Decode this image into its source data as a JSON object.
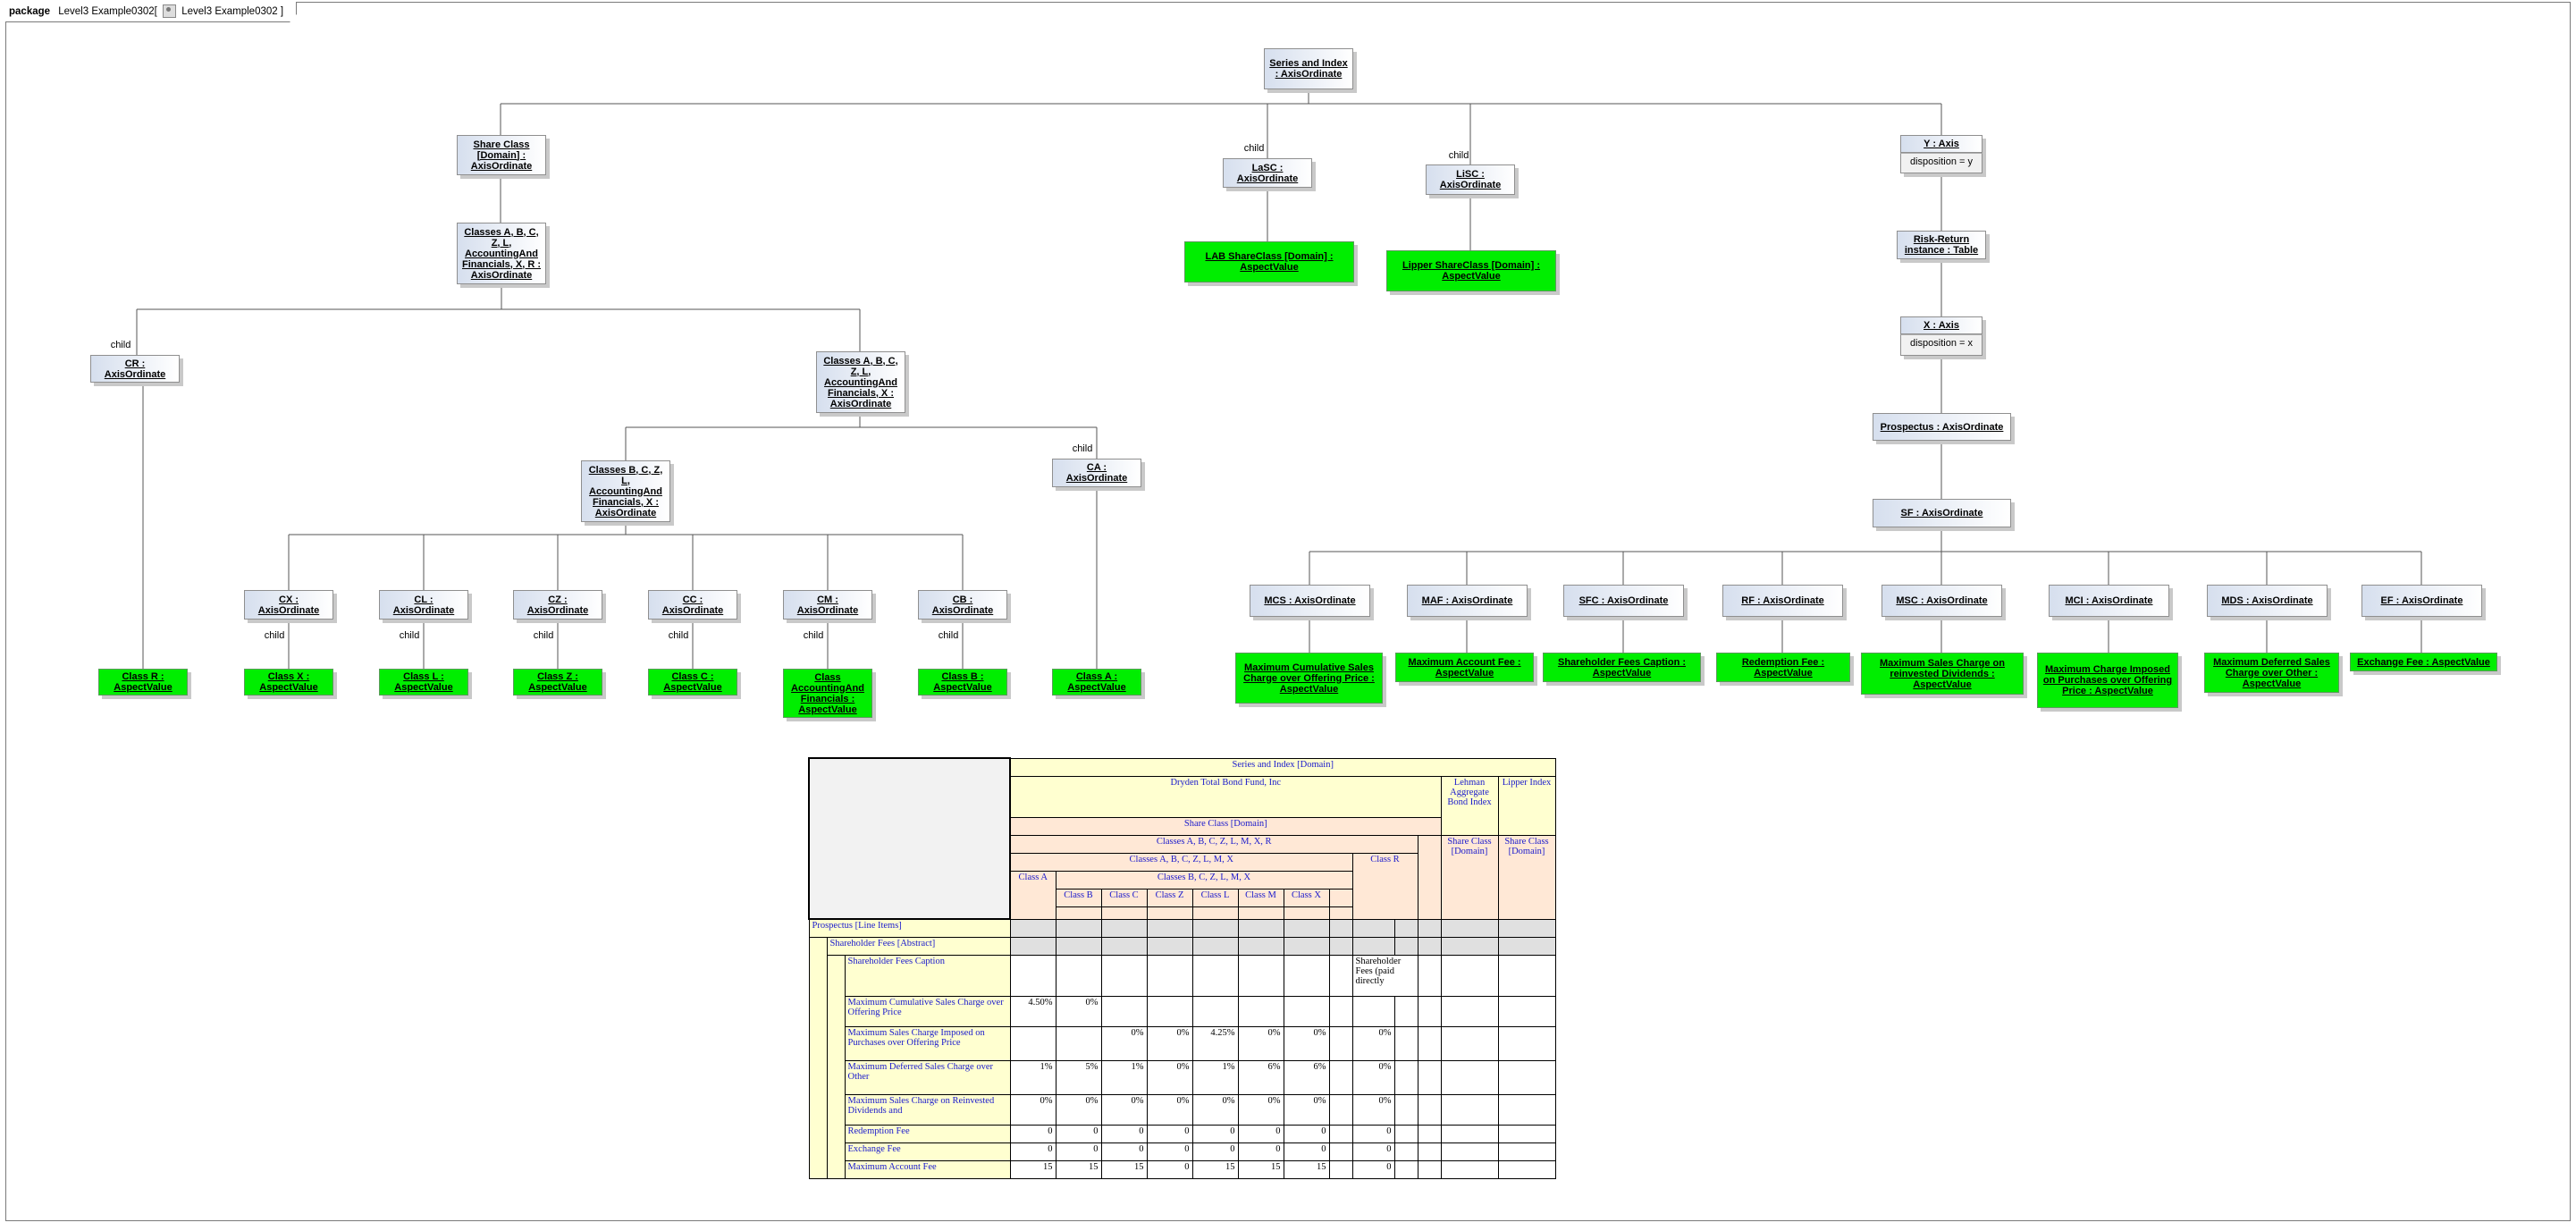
{
  "package": {
    "keyword": "package",
    "name": "Level3 Example0302",
    "diagram_ref": "Level3 Example0302"
  },
  "edge_label": "child",
  "nodes": {
    "series_index": "Series and Index : AxisOrdinate",
    "share_class": "Share Class [Domain] : AxisOrdinate",
    "classes_abcz_r": "Classes A, B, C, Z, L, AccountingAnd Financials, X, R : AxisOrdinate",
    "cr": "CR : AxisOrdinate",
    "classes_abcz_x": "Classes A, B, C, Z, L, AccountingAnd Financials, X : AxisOrdinate",
    "classes_bcz": "Classes B, C, Z, L, AccountingAnd Financials, X : AxisOrdinate",
    "ca": "CA : AxisOrdinate",
    "cx": "CX : AxisOrdinate",
    "cl": "CL : AxisOrdinate",
    "cz": "CZ : AxisOrdinate",
    "cc": "CC : AxisOrdinate",
    "cm": "CM : AxisOrdinate",
    "cb": "CB : AxisOrdinate",
    "class_r": "Class R : AspectValue",
    "class_x": "Class X : AspectValue",
    "class_l": "Class L : AspectValue",
    "class_z": "Class Z : AspectValue",
    "class_c": "Class C : AspectValue",
    "class_af": "Class AccountingAnd Financials : AspectValue",
    "class_b": "Class B : AspectValue",
    "class_a": "Class A : AspectValue",
    "lasc": "LaSC : AxisOrdinate",
    "lisc": "LiSC : AxisOrdinate",
    "lab_shareclass": "LAB ShareClass [Domain] : AspectValue",
    "lipper_shareclass": "Lipper ShareClass [Domain] : AspectValue",
    "y_axis": "Y : Axis",
    "y_disp": "disposition = y",
    "risk_return": "Risk-Return instance : Table",
    "x_axis": "X : Axis",
    "x_disp": "disposition = x",
    "prospectus": "Prospectus : AxisOrdinate",
    "sf": "SF : AxisOrdinate",
    "mcs": "MCS : AxisOrdinate",
    "maf": "MAF : AxisOrdinate",
    "sfc": "SFC : AxisOrdinate",
    "rf": "RF : AxisOrdinate",
    "msc": "MSC : AxisOrdinate",
    "mci": "MCI : AxisOrdinate",
    "mds": "MDS : AxisOrdinate",
    "ef": "EF : AxisOrdinate",
    "mcs_val": "Maximum Cumulative Sales Charge over Offering Price : AspectValue",
    "maf_val": "Maximum Account Fee : AspectValue",
    "sfc_val": "Shareholder Fees Caption : AspectValue",
    "rf_val": "Redemption Fee : AspectValue",
    "msc_val": "Maximum Sales Charge on reinvested Dividends : AspectValue",
    "mci_val": "Maximum Charge Imposed on Purchases over Offering Price : AspectValue",
    "mds_val": "Maximum Deferred Sales Charge over Other : AspectValue",
    "ef_val": "Exchange Fee : AspectValue"
  },
  "table": {
    "series_domain": "Series and Index [Domain]",
    "fund": "Dryden Total Bond Fund, Inc",
    "lehman": "Lehman Aggregate Bond Index",
    "lipper": "Lipper Index",
    "share_class_domain": "Share Class [Domain]",
    "lehman_sc": "Share Class [Domain]",
    "lipper_sc": "Share Class [Domain]",
    "classes_r": "Classes A, B, C, Z, L, M, X, R",
    "classes_x": "Classes A, B, C, Z, L, M, X",
    "class_r": "Class R",
    "class_a": "Class A",
    "classes_bx": "Classes B, C, Z, L, M, X",
    "col_classes": [
      "Class B",
      "Class C",
      "Class Z",
      "Class L",
      "Class M",
      "Class X"
    ],
    "prospectus": "Prospectus [Line Items]",
    "shareholder_fees": "Shareholder Fees [Abstract]",
    "caption_row": {
      "label": "Shareholder Fees Caption",
      "note": "Shareholder Fees (paid directly"
    },
    "rows": [
      {
        "label": "Maximum Cumulative Sales Charge over Offering Price",
        "a": "4.50%",
        "b": "0%",
        "c": "",
        "z": "",
        "l": "",
        "m": "",
        "x": "",
        "r": ""
      },
      {
        "label": "Maximum Sales Charge Imposed on Purchases over Offering Price",
        "a": "",
        "b": "",
        "c": "0%",
        "z": "0%",
        "l": "4.25%",
        "m": "0%",
        "x": "0%",
        "r": "0%"
      },
      {
        "label": "Maximum Deferred Sales Charge over Other",
        "a": "1%",
        "b": "5%",
        "c": "1%",
        "z": "0%",
        "l": "1%",
        "m": "6%",
        "x": "6%",
        "r": "0%"
      },
      {
        "label": "Maximum Sales Charge on Reinvested Dividends and",
        "a": "0%",
        "b": "0%",
        "c": "0%",
        "z": "0%",
        "l": "0%",
        "m": "0%",
        "x": "0%",
        "r": "0%"
      },
      {
        "label": "Redemption Fee",
        "a": "0",
        "b": "0",
        "c": "0",
        "z": "0",
        "l": "0",
        "m": "0",
        "x": "0",
        "r": "0"
      },
      {
        "label": "Exchange Fee",
        "a": "0",
        "b": "0",
        "c": "0",
        "z": "0",
        "l": "0",
        "m": "0",
        "x": "0",
        "r": "0"
      },
      {
        "label": "Maximum Account Fee",
        "a": "15",
        "b": "15",
        "c": "15",
        "z": "0",
        "l": "15",
        "m": "15",
        "x": "15",
        "r": "0"
      }
    ]
  }
}
